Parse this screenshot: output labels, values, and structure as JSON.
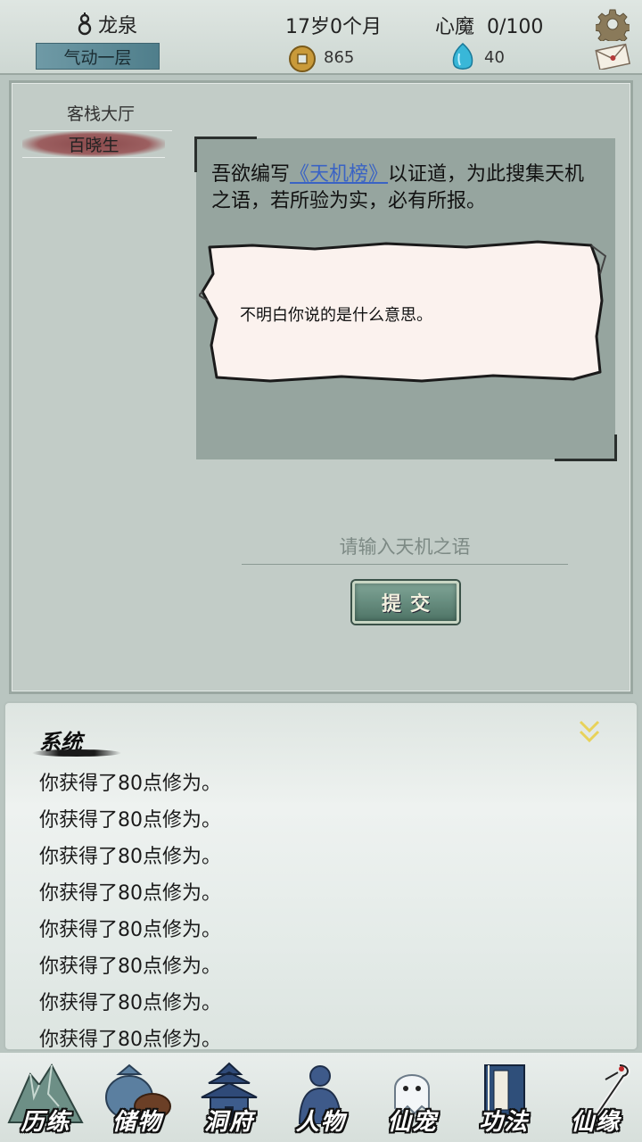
{
  "header": {
    "character_name": "龙泉",
    "realm": "气动一层",
    "age": "17岁0个月",
    "heart_demon": "心魔  0/100",
    "coins": "865",
    "spirit_stones": "40",
    "icons": {
      "name": "gourd-icon",
      "settings": "gear-icon",
      "mail": "mail-icon",
      "coin": "coin-icon",
      "stone": "spirit-stone-icon"
    }
  },
  "scene": {
    "location": "客栈大厅",
    "npc": "百晓生",
    "dialog": {
      "before_link": "吾欲编写",
      "link": "《天机榜》",
      "after_link": "以证道，为此搜集天机之语，若所验为实，必有所报。"
    },
    "note_text": "不明白你说的是什么意思。",
    "input_placeholder": "请输入天机之语",
    "input_value": "",
    "submit_label": "提交"
  },
  "log": {
    "title": "系统",
    "entries": [
      "你获得了80点修为。",
      "你获得了80点修为。",
      "你获得了80点修为。",
      "你获得了80点修为。",
      "你获得了80点修为。",
      "你获得了80点修为。",
      "你获得了80点修为。",
      "你获得了80点修为。"
    ]
  },
  "nav": [
    {
      "label": "历练",
      "icon": "mountain-icon"
    },
    {
      "label": "储物",
      "icon": "storage-bag-icon"
    },
    {
      "label": "洞府",
      "icon": "pagoda-icon"
    },
    {
      "label": "人物",
      "icon": "person-icon"
    },
    {
      "label": "仙宠",
      "icon": "spirit-pet-icon"
    },
    {
      "label": "功法",
      "icon": "book-icon"
    },
    {
      "label": "仙缘",
      "icon": "crane-icon"
    }
  ],
  "colors": {
    "realm_bar": "#5e8c98",
    "link": "#3a63c4",
    "npc_tab": "#8a4a4c",
    "submit_button": "#5b8072"
  }
}
